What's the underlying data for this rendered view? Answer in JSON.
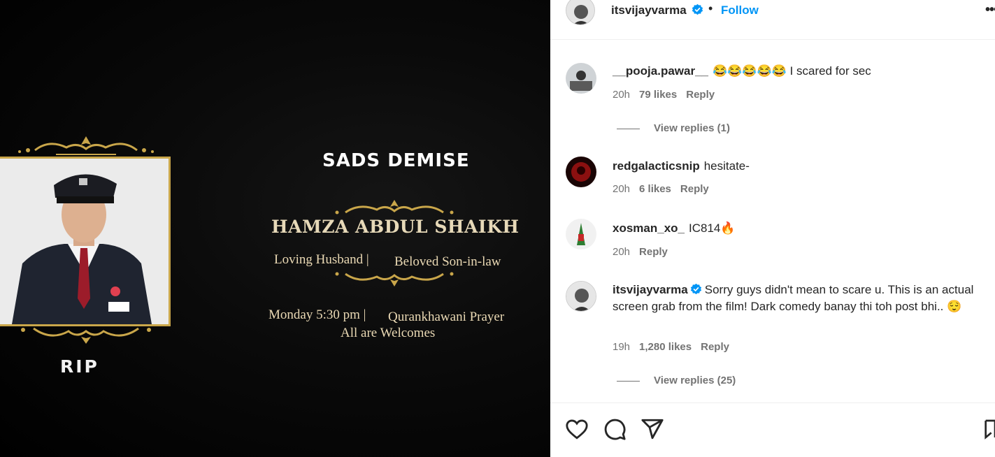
{
  "media": {
    "heading": "SADS DEMISE",
    "name": "HAMZA ABDUL SHAIKH",
    "line1_left": "Loving Husband  |",
    "line1_right": "Beloved Son-in-law",
    "line2_left": "Monday 5:30 pm  |",
    "line2_right": "Qurankhawani Prayer",
    "line3": "All are Welcomes",
    "rip": "RIP",
    "accent_color": "#c9a64a"
  },
  "header": {
    "username": "itsvijayvarma",
    "separator": "•",
    "follow_label": "Follow",
    "more_label": "•••"
  },
  "comments": [
    {
      "username": "__pooja.pawar__",
      "text": "😂😂😂😂😂 I scared for sec",
      "time": "20h",
      "likes": "79 likes",
      "reply": "Reply",
      "view_replies": "View replies (1)"
    },
    {
      "username": "redgalacticsnip",
      "text": "hesitate-",
      "time": "20h",
      "likes": "6 likes",
      "reply": "Reply"
    },
    {
      "username": "xosman_xo_",
      "text": "IC814🔥",
      "time": "20h",
      "reply": "Reply"
    },
    {
      "username": "itsvijayvarma",
      "text": "Sorry guys didn't mean to scare u. This is an actual screen grab from the film! Dark comedy banay thi toh post bhi.. 😌",
      "time": "19h",
      "likes": "1,280 likes",
      "reply": "Reply",
      "view_replies": "View replies (25)",
      "verified": true
    }
  ],
  "actions": [
    "like-icon",
    "comment-icon",
    "share-icon",
    "save-icon"
  ]
}
